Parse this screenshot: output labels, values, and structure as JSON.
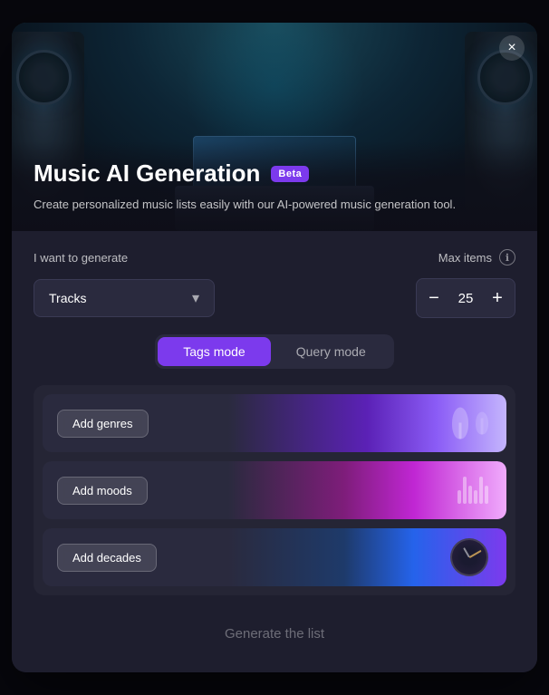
{
  "modal": {
    "title": "Music AI Generation",
    "beta_label": "Beta",
    "subtitle": "Create personalized music lists easily with our AI-powered music generation tool.",
    "close_label": "×",
    "generate_label": "Generate the list"
  },
  "controls": {
    "want_label": "I want to generate",
    "max_items_label": "Max items",
    "info_icon": "ℹ",
    "dropdown_value": "Tracks",
    "dropdown_chevron": "▾",
    "stepper_value": "25",
    "stepper_minus": "−",
    "stepper_plus": "+"
  },
  "mode_toggle": {
    "tags_label": "Tags mode",
    "query_label": "Query mode"
  },
  "tag_rows": [
    {
      "id": "genres",
      "label": "Add genres"
    },
    {
      "id": "moods",
      "label": "Add moods"
    },
    {
      "id": "decades",
      "label": "Add decades"
    }
  ],
  "colors": {
    "accent": "#7c3aed",
    "accent_light": "#8b5cf6"
  }
}
